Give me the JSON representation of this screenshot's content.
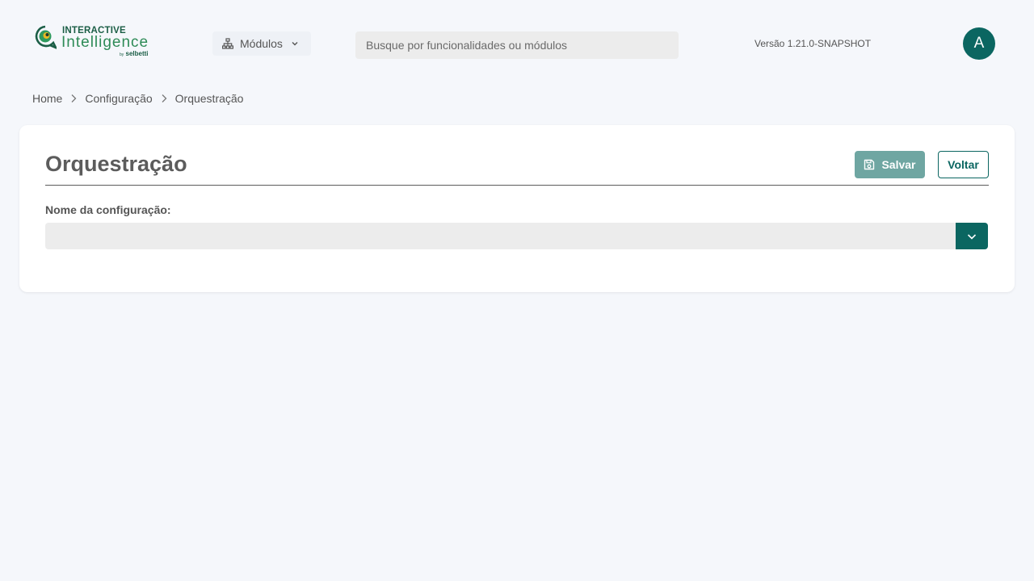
{
  "brand": {
    "line1": "INTERACTIVE",
    "line2": "Intelligence",
    "by": "by",
    "company": "selbetti"
  },
  "header": {
    "modules_label": "Módulos",
    "search_placeholder": "Busque por funcionalidades ou módulos",
    "search_value": "",
    "version": "Versão 1.21.0-SNAPSHOT",
    "avatar_initial": "A"
  },
  "breadcrumb": [
    {
      "label": "Home"
    },
    {
      "label": "Configuração"
    },
    {
      "label": "Orquestração"
    }
  ],
  "page": {
    "title": "Orquestração",
    "save_label": "Salvar",
    "back_label": "Voltar",
    "field_label": "Nome da configuração:",
    "field_value": ""
  },
  "colors": {
    "primary": "#0b6661",
    "save_disabled": "#6fa6a2",
    "background": "#f5f7fb",
    "input_bg": "#ececec"
  },
  "icons": {
    "modules": "sitemap-icon",
    "modules_caret": "chevron-down-icon",
    "breadcrumb_sep": "chevron-right-icon",
    "save": "floppy-disk-icon",
    "select_toggle": "chevron-down-icon"
  }
}
